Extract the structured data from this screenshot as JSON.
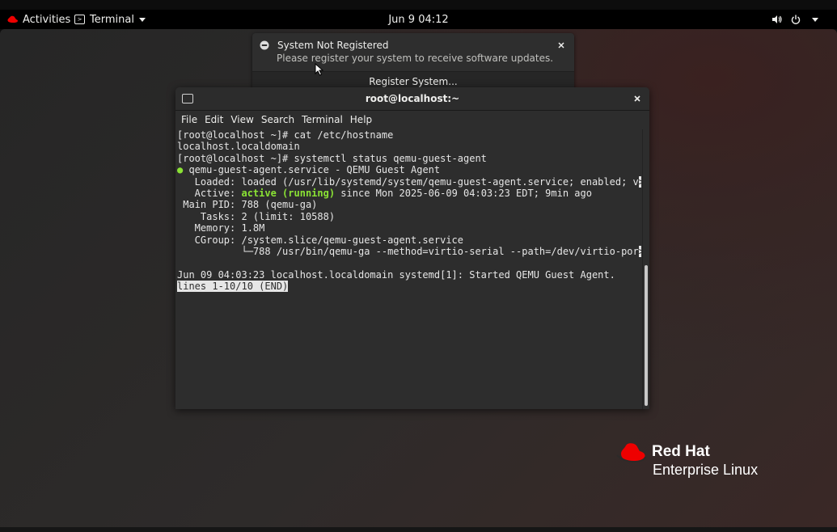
{
  "topbar": {
    "activities_label": "Activities",
    "app_label": "Terminal",
    "clock": "Jun 9  04:12",
    "tray_icons": [
      "volume-icon",
      "power-icon",
      "chevron-down-icon"
    ]
  },
  "notification": {
    "title": "System Not Registered",
    "body": "Please register your system to receive software updates.",
    "action_label": "Register System...",
    "icon": "minus-circle-icon"
  },
  "terminal": {
    "title": "root@localhost:~",
    "menu": [
      "File",
      "Edit",
      "View",
      "Search",
      "Terminal",
      "Help"
    ],
    "lines": {
      "l1": "[root@localhost ~]# cat /etc/hostname",
      "l2": "localhost.localdomain",
      "l3": "[root@localhost ~]# systemctl status qemu-guest-agent",
      "l4_dot": "●",
      "l4": " qemu-guest-agent.service - QEMU Guest Agent",
      "l5": "   Loaded: loaded (/usr/lib/systemd/system/qemu-guest-agent.service; enabled; v",
      "l5_trunc": ">",
      "l6_pre": "   Active: ",
      "l6_active": "active (running)",
      "l6_post": " since Mon 2025-06-09 04:03:23 EDT; 9min ago",
      "l7": " Main PID: 788 (qemu-ga)",
      "l8": "    Tasks: 2 (limit: 10588)",
      "l9": "   Memory: 1.8M",
      "l10": "   CGroup: /system.slice/qemu-guest-agent.service",
      "l11": "           └─788 /usr/bin/qemu-ga --method=virtio-serial --path=/dev/virtio-por",
      "l11_trunc": ">",
      "l12": "",
      "l13": "Jun 09 04:03:23 localhost.localdomain systemd[1]: Started QEMU Guest Agent.",
      "status": "lines 1-10/10 (END)"
    }
  },
  "branding": {
    "line1": "Red Hat",
    "line2": "Enterprise Linux",
    "hat_color": "#ee0000"
  },
  "colors": {
    "accent_green": "#8ae234",
    "topbar_bg": "#000000",
    "terminal_bg": "#2d2d2d"
  }
}
